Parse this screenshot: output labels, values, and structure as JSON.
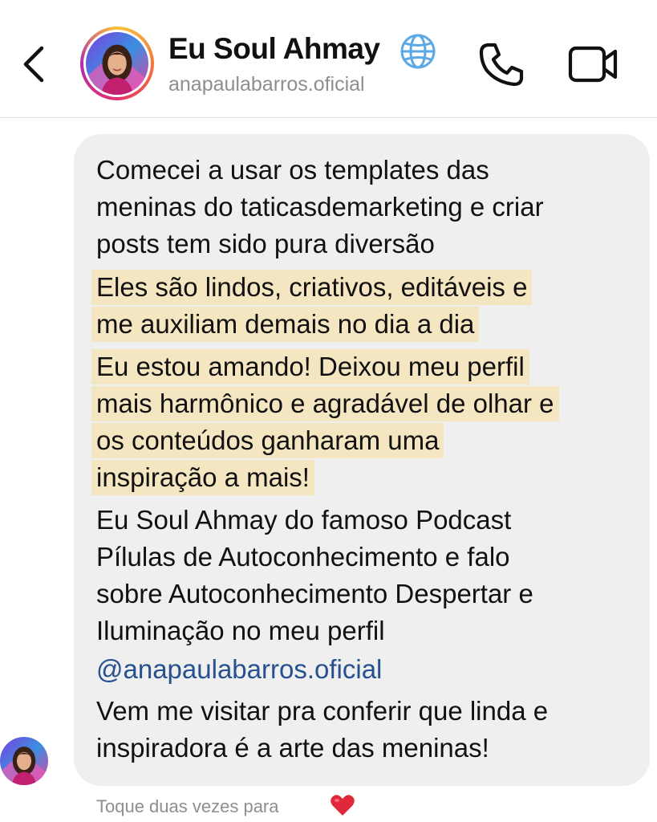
{
  "header": {
    "profile_name": "Eu Soul Ahmay",
    "profile_handle": "anapaulabarros.oficial",
    "icons": {
      "back": "chevron-left-icon",
      "verified_globe": "globe-icon",
      "call": "phone-icon",
      "video": "video-camera-icon"
    }
  },
  "message": {
    "lines": [
      "Comecei a usar os templates das",
      "meninas do taticasdemarketing e criar",
      "posts tem sido pura diversão",
      "Eles são lindos, criativos, editáveis e",
      "me auxiliam demais no dia a dia",
      "Eu estou amando! Deixou meu perfil",
      "mais harmônico e agradável de olhar e",
      "os conteúdos ganharam uma",
      "inspiração a mais!",
      "Eu Soul Ahmay do famoso Podcast",
      "Pílulas de Autoconhecimento e falo",
      "sobre Autoconhecimento Despertar e",
      "Iluminação no meu perfil",
      "@anapaulabarros.oficial",
      "Vem me visitar pra conferir que linda e",
      "inspiradora é a arte das meninas!"
    ],
    "highlight_color": "#f5e6c2",
    "mention_color": "#26508f"
  },
  "footer": {
    "reaction_hint": "Toque duas vezes para",
    "reaction_icon": "heart-icon"
  },
  "colors": {
    "bubble": "#efefef",
    "muted_text": "#8e8e8e",
    "heart": "#e0283b"
  }
}
